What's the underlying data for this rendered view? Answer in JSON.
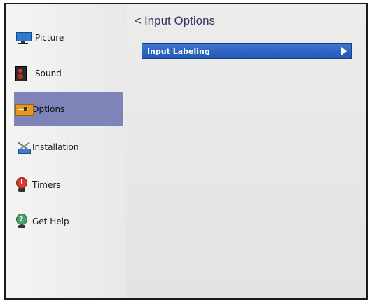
{
  "sidebar": {
    "items": [
      {
        "label": "Picture",
        "icon": "picture-icon"
      },
      {
        "label": "Sound",
        "icon": "sound-icon"
      },
      {
        "label": "Options",
        "icon": "options-icon",
        "selected": true
      },
      {
        "label": "Installation",
        "icon": "installation-icon"
      },
      {
        "label": "Timers",
        "icon": "timers-icon"
      },
      {
        "label": "Get Help",
        "icon": "help-icon"
      }
    ]
  },
  "main": {
    "back_glyph": "<",
    "title": "Input Options",
    "menu": [
      {
        "label": "Input Labeling",
        "has_submenu": true
      }
    ]
  },
  "colors": {
    "selection": "#7f84b8",
    "menu_highlight": "#2a62c2",
    "title_text": "#36366a"
  }
}
